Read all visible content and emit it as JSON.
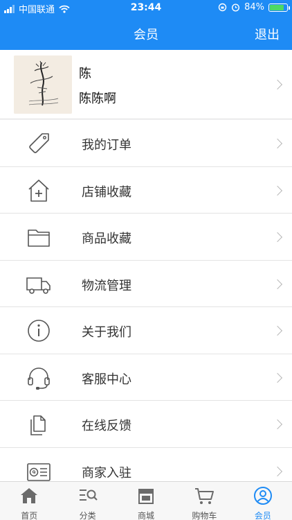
{
  "status_bar": {
    "carrier": "中国联通",
    "time": "23:44",
    "battery": "84%",
    "battery_level": 0.84
  },
  "header": {
    "title": "会员",
    "logout_label": "退出"
  },
  "profile": {
    "name": "陈",
    "nickname": "陈陈啊"
  },
  "menu": [
    {
      "label": "我的订单",
      "icon": "tag-icon"
    },
    {
      "label": "店铺收藏",
      "icon": "store-add-icon"
    },
    {
      "label": "商品收藏",
      "icon": "folder-icon"
    },
    {
      "label": "物流管理",
      "icon": "truck-icon"
    },
    {
      "label": "关于我们",
      "icon": "info-icon"
    },
    {
      "label": "客服中心",
      "icon": "headset-icon"
    },
    {
      "label": "在线反馈",
      "icon": "documents-icon"
    },
    {
      "label": "商家入驻",
      "icon": "merchant-card-icon"
    }
  ],
  "tabbar": [
    {
      "label": "首页",
      "icon": "home-icon",
      "active": false
    },
    {
      "label": "分类",
      "icon": "category-search-icon",
      "active": false
    },
    {
      "label": "商城",
      "icon": "shop-icon",
      "active": false
    },
    {
      "label": "购物车",
      "icon": "cart-icon",
      "active": false
    },
    {
      "label": "会员",
      "icon": "user-icon",
      "active": true
    }
  ],
  "colors": {
    "primary": "#1e8bf5",
    "battery_green": "#4cd964"
  }
}
